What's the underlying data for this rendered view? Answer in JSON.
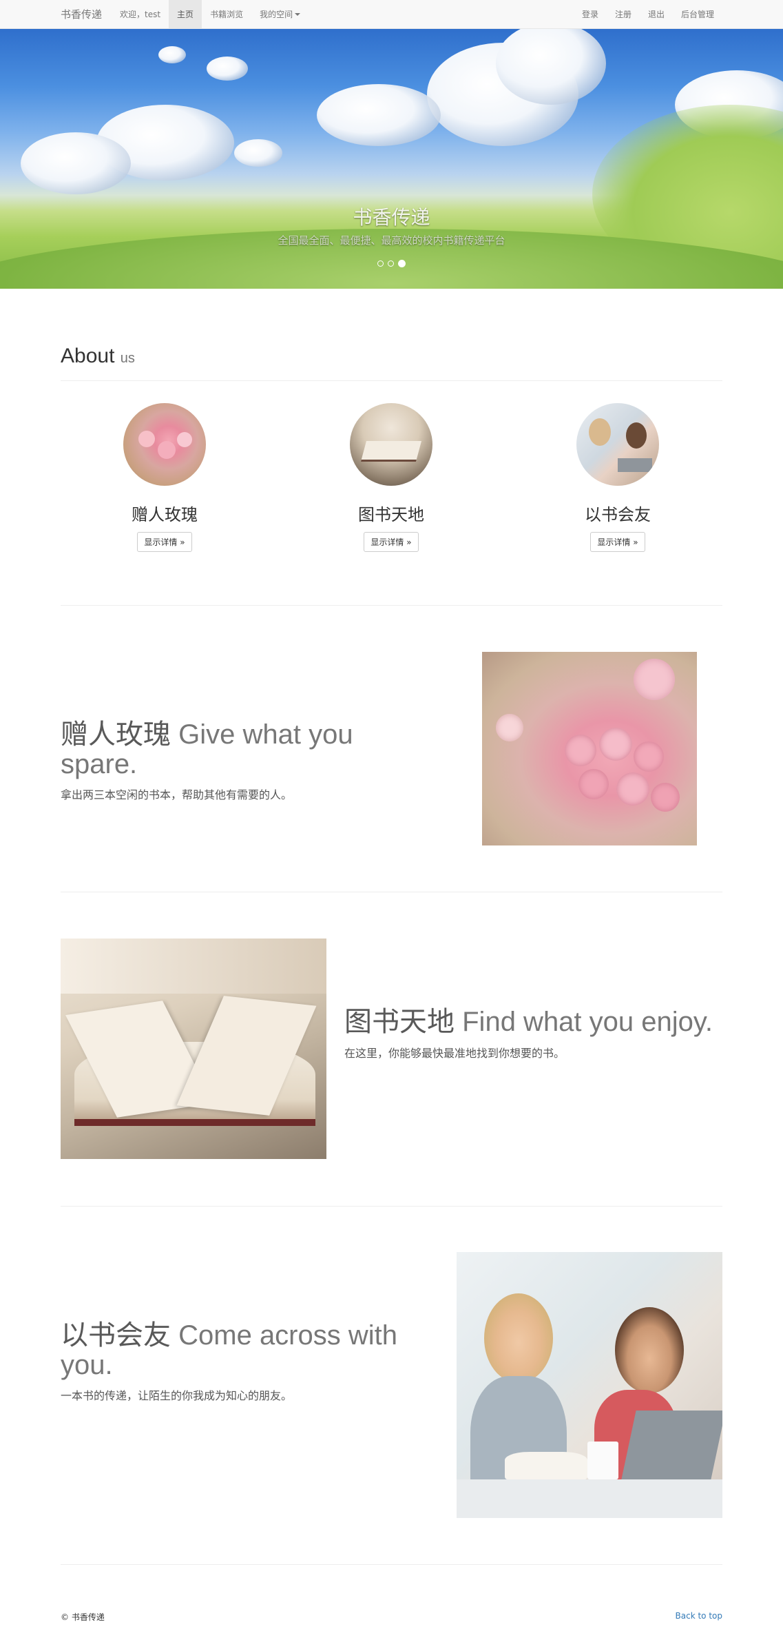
{
  "navbar": {
    "brand": "书香传递",
    "left_items": [
      {
        "label": "欢迎，test",
        "active": false
      },
      {
        "label": "主页",
        "active": true
      },
      {
        "label": "书籍浏览",
        "active": false
      },
      {
        "label": "我的空间",
        "active": false,
        "dropdown": true
      }
    ],
    "right_items": [
      {
        "label": "登录"
      },
      {
        "label": "注册"
      },
      {
        "label": "退出"
      },
      {
        "label": "后台管理"
      }
    ]
  },
  "carousel": {
    "title": "书香传递",
    "subtitle": "全国最全面、最便捷、最高效的校内书籍传递平台",
    "slide_count": 3,
    "active_index": 2
  },
  "about": {
    "heading": "About",
    "heading_small": "us",
    "columns": [
      {
        "title": "赠人玫瑰",
        "button": "显示详情 »",
        "image": "roses-photo"
      },
      {
        "title": "图书天地",
        "button": "显示详情 »",
        "image": "open-book-photo"
      },
      {
        "title": "以书会友",
        "button": "显示详情 »",
        "image": "friends-photo"
      }
    ]
  },
  "featurettes": [
    {
      "heading": "赠人玫瑰",
      "muted": "Give what you spare.",
      "lead": "拿出两三本空闲的书本，帮助其他有需要的人。"
    },
    {
      "heading": "图书天地",
      "muted": "Find what you enjoy.",
      "lead": "在这里，你能够最快最准地找到你想要的书。"
    },
    {
      "heading": "以书会友",
      "muted": "Come across with you.",
      "lead": "一本书的传递，让陌生的你我成为知心的朋友。"
    }
  ],
  "footer": {
    "copyright": "© 书香传递",
    "back_to_top": "Back to top"
  }
}
